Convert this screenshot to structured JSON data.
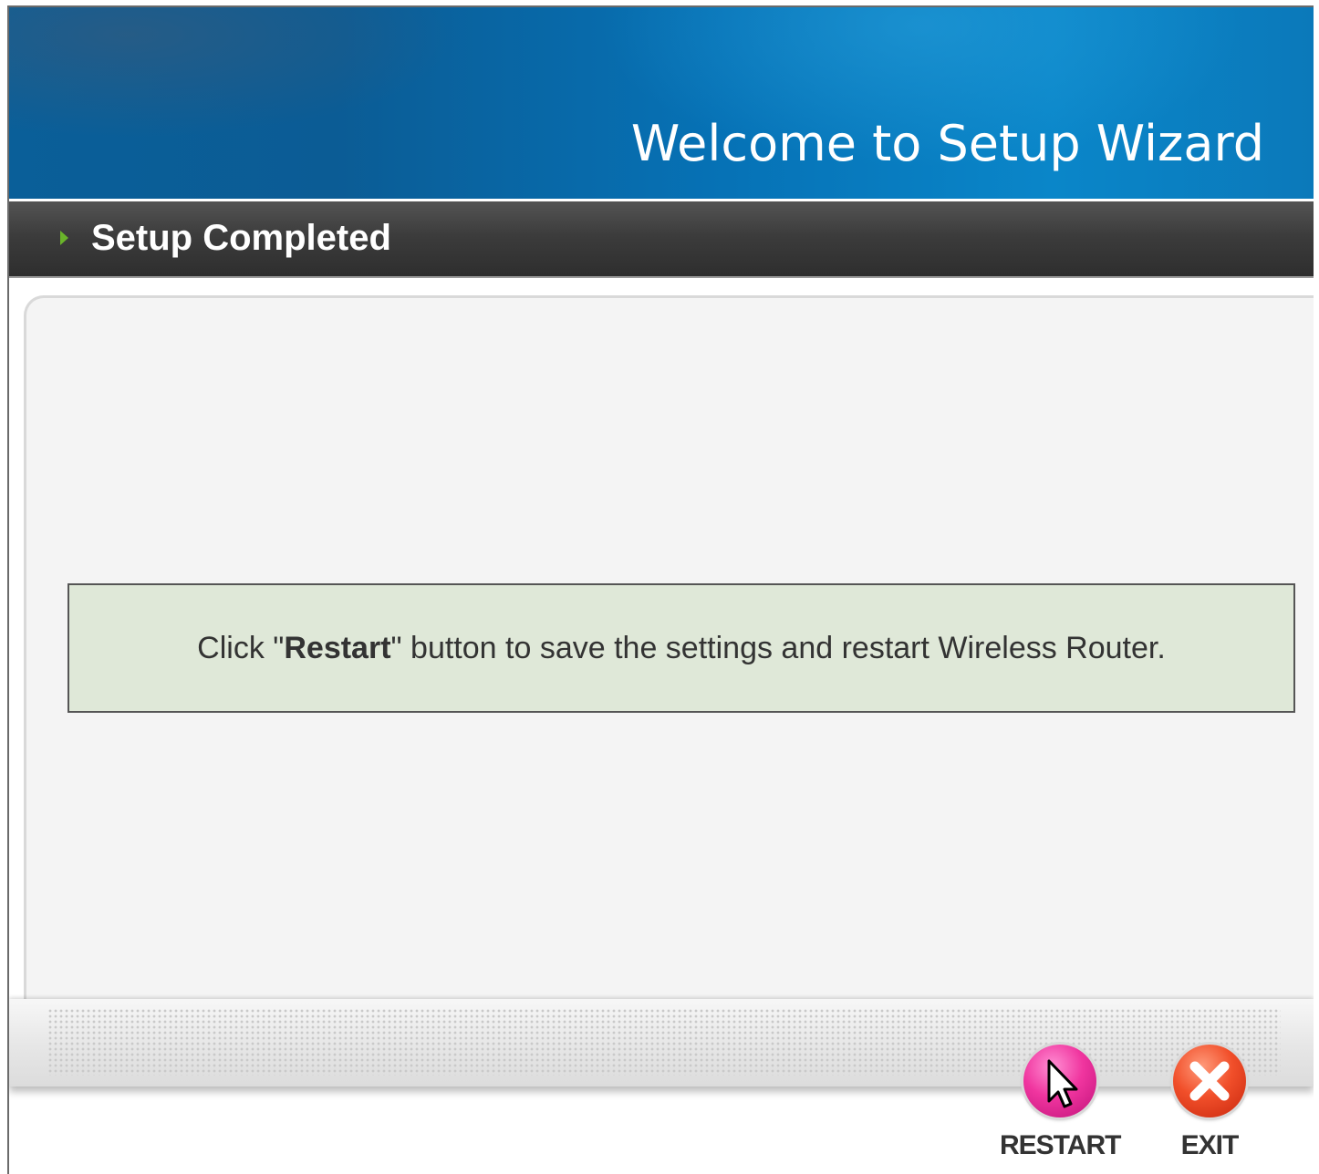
{
  "header": {
    "title": "Welcome to Setup Wizard"
  },
  "section": {
    "title": "Setup Completed"
  },
  "message": {
    "prefix": "Click \"",
    "emphasis": "Restart",
    "suffix": "\" button to save the settings and restart Wireless Router."
  },
  "buttons": {
    "restart_label": "RESTART",
    "exit_label": "EXIT"
  },
  "colors": {
    "banner": "#0672b6",
    "section_bar": "#3c3c3c",
    "message_bg": "#dfe8d8",
    "restart": "#f0359f",
    "exit": "#f14f2a",
    "arrow": "#6ab42a"
  },
  "icons": {
    "section": "play-arrow-icon",
    "restart": "restart-icon",
    "exit": "close-icon",
    "cursor": "mouse-pointer-icon"
  }
}
